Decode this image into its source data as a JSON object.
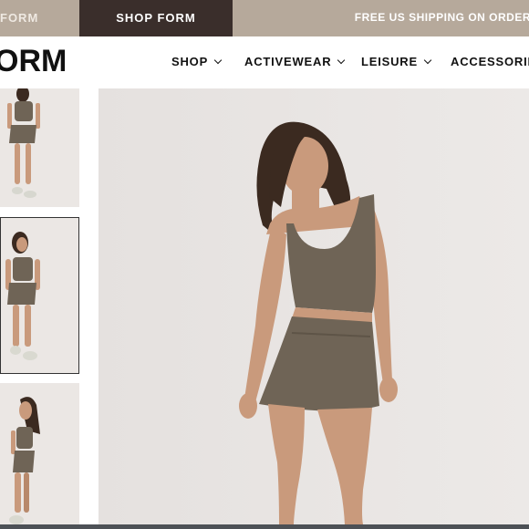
{
  "promo_bar": {
    "left_tab_label": "FORM",
    "shop_tab_label": "SHOP FORM",
    "shipping_text": "FREE US SHIPPING ON ORDER"
  },
  "header": {
    "logo_text": "ORM",
    "nav_items": [
      {
        "label": "SHOP"
      },
      {
        "label": "ACTIVEWEAR"
      },
      {
        "label": "LEISURE"
      },
      {
        "label": "ACCESSORIES"
      }
    ]
  },
  "product": {
    "thumbnails": [
      {
        "alt": "model-front-view"
      },
      {
        "alt": "model-front-view-selected"
      },
      {
        "alt": "model-side-view"
      }
    ],
    "main_image": "model-in-brown-tank-and-skirt"
  },
  "colors": {
    "promo_bg": "#b6a99b",
    "shop_tab_bg": "#3a2e2b",
    "garment": "#6f6456",
    "skin": "#c99a7c",
    "hair": "#3b2a20",
    "photo_bg": "#e9e5e3"
  }
}
